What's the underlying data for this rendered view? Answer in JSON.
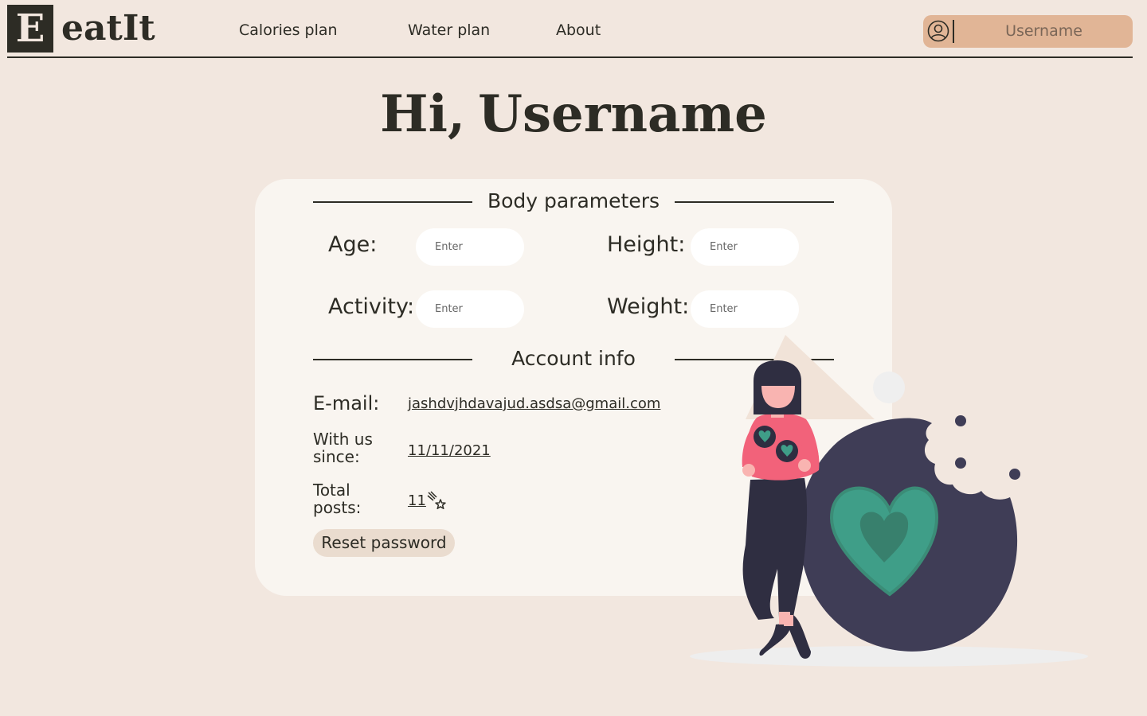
{
  "header": {
    "logo_letter": "E",
    "logo_text": "eatIt",
    "nav": [
      "Calories plan",
      "Water plan",
      "About"
    ],
    "user_button_label": "Username"
  },
  "greeting": {
    "prefix": "Hi,",
    "name": "Username"
  },
  "body_parameters": {
    "title": "Body parameters",
    "fields": [
      {
        "label": "Age:",
        "placeholder": "Enter"
      },
      {
        "label": "Height:",
        "placeholder": "Enter"
      },
      {
        "label": "Activity:",
        "placeholder": "Enter"
      },
      {
        "label": "Weight:",
        "placeholder": "Enter"
      }
    ]
  },
  "account_info": {
    "title": "Account info",
    "email_label": "E-mail:",
    "email_value": "jashdvjhdavajud.asdsa@gmail.com",
    "since_label_line1": "With us",
    "since_label_line2": "since:",
    "since_value": "11/11/2021",
    "posts_label_line1": "Total",
    "posts_label_line2": "posts:",
    "posts_value": "11",
    "reset_button": "Reset password"
  },
  "colors": {
    "background": "#f2e7df",
    "card": "#f9f5f0",
    "dark": "#2d2c25",
    "accent": "#e1b596",
    "heart": "#3f9e88",
    "cookie": "#3f3d56",
    "shirt": "#f2627a"
  },
  "icons": [
    "user-icon",
    "shooting-star-icon"
  ]
}
